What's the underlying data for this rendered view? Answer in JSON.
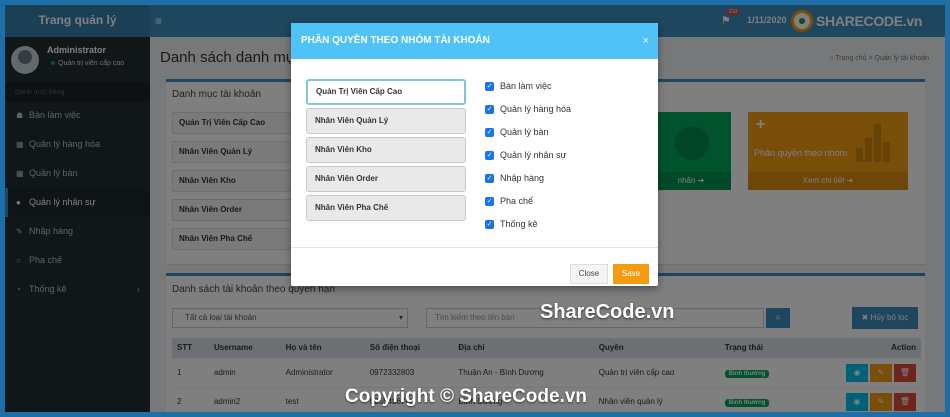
{
  "topbar": {
    "brand": "Trang quản lý",
    "menu_icon": "bars-icon",
    "notification_count": "213",
    "date": "1/11/2020",
    "logo_text": "SHARECODE.vn"
  },
  "sidebar": {
    "user_name": "Administrator",
    "user_role": "Quản trị viên cấp cao",
    "section_header": "Danh mục bảng",
    "items": [
      {
        "icon": "☗",
        "label": "Bàn làm việc"
      },
      {
        "icon": "▦",
        "label": "Quản lý hàng hóa"
      },
      {
        "icon": "▦",
        "label": "Quản lý bàn"
      },
      {
        "icon": "●",
        "label": "Quản lý nhân sự"
      },
      {
        "icon": "✎",
        "label": "Nhập hàng"
      },
      {
        "icon": "○",
        "label": "Pha chế"
      },
      {
        "icon": "◔",
        "label": "Thống kê"
      }
    ]
  },
  "page": {
    "title": "Danh sách danh mục tài khoản",
    "breadcrumb_home": "Trang chủ",
    "breadcrumb_sep": ">",
    "breadcrumb_current": "Quản lý tài khoản"
  },
  "category_box": {
    "title": "Danh mục tài khoản",
    "groups": [
      "Quản Trị Viên Cấp Cao",
      "Nhân Viên Quản Lý",
      "Nhân Viên Kho",
      "Nhân Viên Order",
      "Nhân Viên Pha Chế"
    ],
    "tile_green_footer": "nhân",
    "tile_orange_plus": "+",
    "tile_orange_title": "Phân quyền theo nhóm",
    "tile_orange_footer": "Xem chi tiết"
  },
  "account_box": {
    "title": "Danh sách tài khoản theo quyền hạn",
    "filter_select": "Tất cả loại tài khoản",
    "search_placeholder": "Tìm kiếm theo tên bàn",
    "clear_filter_label": "✖ Hủy bộ lọc",
    "columns": [
      "STT",
      "Username",
      "Họ và tên",
      "Số điện thoại",
      "Địa chỉ",
      "Quyền",
      "Trạng thái",
      "Action"
    ],
    "rows": [
      {
        "stt": "1",
        "username": "admin",
        "name": "Administrator",
        "phone": "0972332803",
        "address": "Thuận An - Bình Dương",
        "role": "Quản trị viên cấp cao",
        "status": "Bình thường"
      },
      {
        "stt": "2",
        "username": "admin2",
        "name": "test",
        "phone": "0355486786",
        "address": "Bình Dương",
        "role": "Nhân viên quản lý",
        "status": "Bình thường"
      }
    ]
  },
  "modal": {
    "title": "PHÂN QUYỀN THEO NHÓM TÀI KHOẢN",
    "close_x": "×",
    "roles": [
      "Quản Trị Viên Cấp Cao",
      "Nhân Viên Quản Lý",
      "Nhân Viên Kho",
      "Nhân Viên Order",
      "Nhân Viên Pha Chế"
    ],
    "selected_role_index": 0,
    "permissions": [
      {
        "label": "Bàn làm việc",
        "checked": true
      },
      {
        "label": "Quản lý hàng hóa",
        "checked": true
      },
      {
        "label": "Quản lý bàn",
        "checked": true
      },
      {
        "label": "Quản lý nhân sự",
        "checked": true
      },
      {
        "label": "Nhập hàng",
        "checked": true
      },
      {
        "label": "Pha chế",
        "checked": true
      },
      {
        "label": "Thống kê",
        "checked": true
      }
    ],
    "close_button": "Close",
    "save_button": "Save"
  },
  "watermarks": {
    "center": "ShareCode.vn",
    "bottom": "Copyright © ShareCode.vn"
  },
  "colors": {
    "primary": "#3c8dbc",
    "modal_header": "#4fc3f7",
    "save": "#f39c12",
    "success": "#00a65a",
    "sidebar": "#222d32"
  }
}
